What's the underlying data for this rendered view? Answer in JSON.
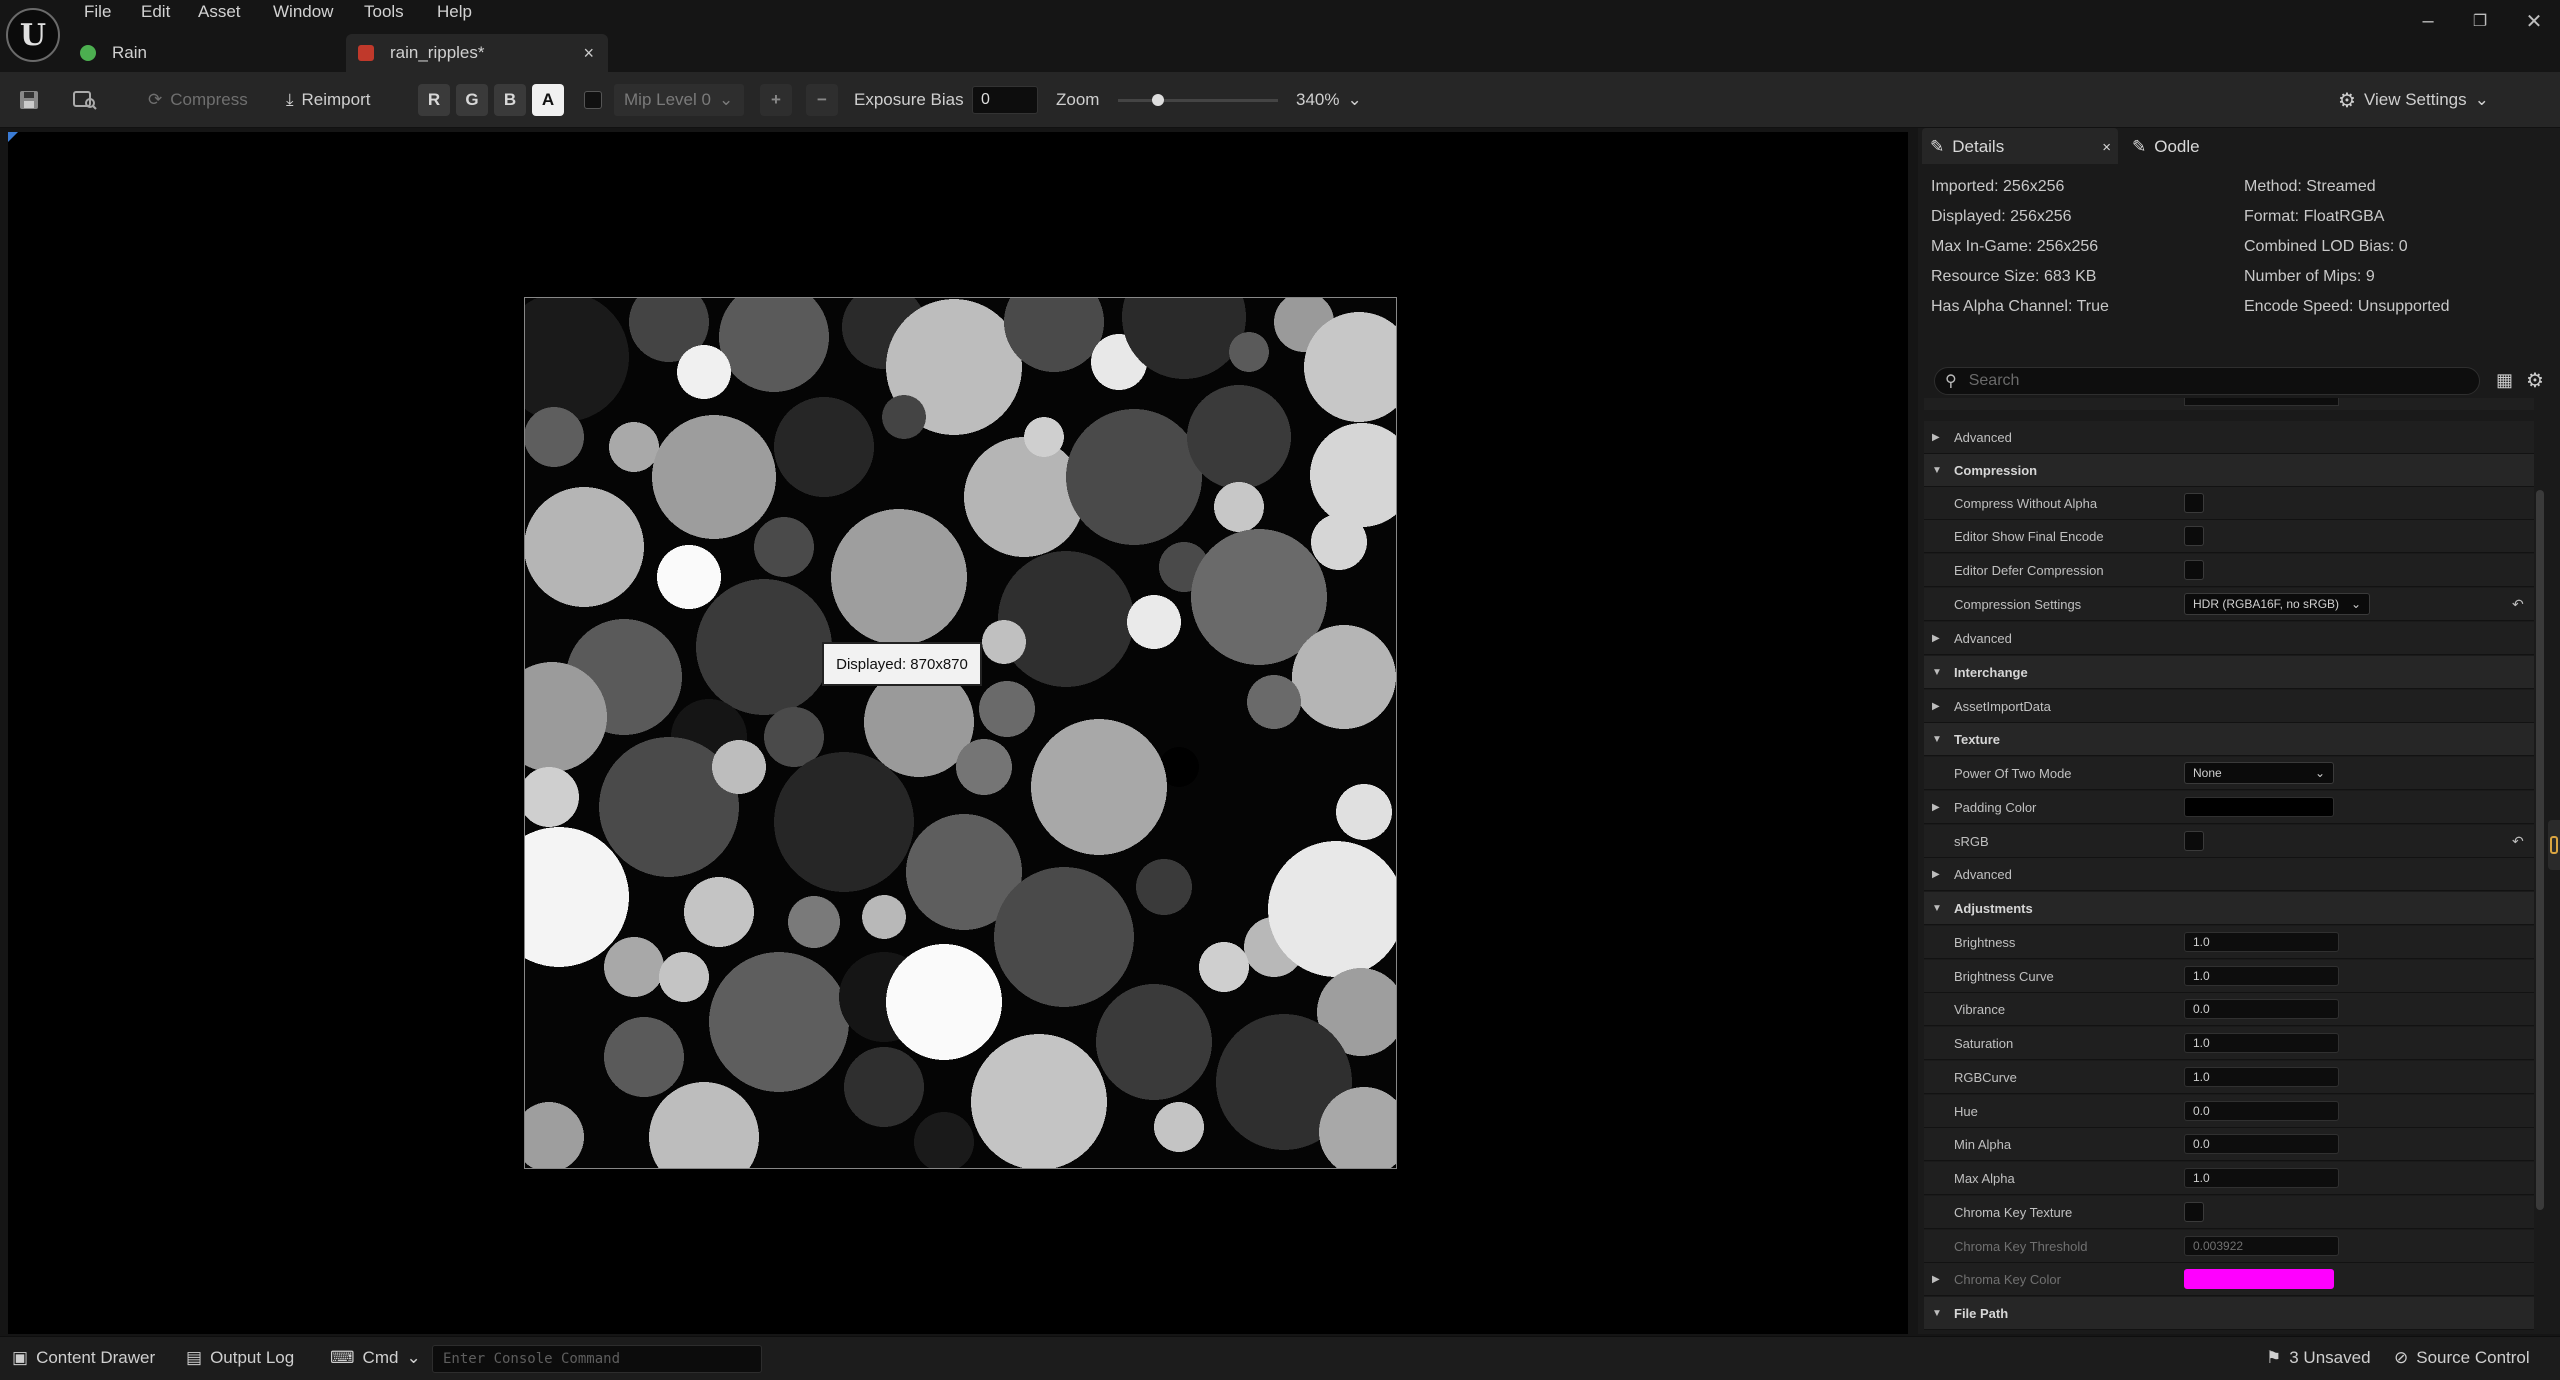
{
  "menu": [
    "File",
    "Edit",
    "Asset",
    "Window",
    "Tools",
    "Help"
  ],
  "tabs": [
    {
      "label": "Rain"
    },
    {
      "label": "rain_ripples*"
    }
  ],
  "toolbar": {
    "compress": "Compress",
    "reimport": "Reimport",
    "channels": [
      "R",
      "G",
      "B",
      "A"
    ],
    "mip": "Mip Level 0",
    "exposure_label": "Exposure Bias",
    "exposure_value": "0",
    "zoom_label": "Zoom",
    "zoom_value": "340%",
    "zoom_slider_fraction": 0.25,
    "view_settings": "View Settings"
  },
  "viewport": {
    "tooltip": "Displayed: 870x870"
  },
  "panel": {
    "tabs": [
      "Details",
      "Oodle"
    ],
    "info_left": [
      "Imported: 256x256",
      "Displayed: 256x256",
      "Max In-Game: 256x256",
      "Resource Size: 683 KB",
      "Has Alpha Channel: True"
    ],
    "info_right": [
      "Method: Streamed",
      "Format: FloatRGBA",
      "Combined LOD Bias: 0",
      "Number of Mips: 9",
      "Encode Speed: Unsupported"
    ],
    "search_placeholder": "Search",
    "props": {
      "advanced": "Advanced",
      "compression": "Compression",
      "compress_without_alpha": "Compress Without Alpha",
      "editor_show_final_encode": "Editor Show Final Encode",
      "editor_defer_compression": "Editor Defer Compression",
      "compression_settings": "Compression Settings",
      "compression_settings_value": "HDR (RGBA16F, no sRGB)",
      "interchange": "Interchange",
      "asset_import_data": "AssetImportData",
      "texture": "Texture",
      "power_of_two_mode": "Power Of Two Mode",
      "power_of_two_value": "None",
      "padding_color": "Padding Color",
      "srgb": "sRGB",
      "adjustments": "Adjustments",
      "brightness": "Brightness",
      "brightness_value": "1.0",
      "brightness_curve": "Brightness Curve",
      "brightness_curve_value": "1.0",
      "vibrance": "Vibrance",
      "vibrance_value": "0.0",
      "saturation": "Saturation",
      "saturation_value": "1.0",
      "rgbcurve": "RGBCurve",
      "rgbcurve_value": "1.0",
      "hue": "Hue",
      "hue_value": "0.0",
      "min_alpha": "Min Alpha",
      "min_alpha_value": "0.0",
      "max_alpha": "Max Alpha",
      "max_alpha_value": "1.0",
      "chroma_key_texture": "Chroma Key Texture",
      "chroma_key_threshold": "Chroma Key Threshold",
      "chroma_key_threshold_value": "0.003922",
      "chroma_key_color": "Chroma Key Color",
      "file_path": "File Path"
    },
    "colors": {
      "chroma_key": "#ff00ff",
      "padding": "#000000"
    }
  },
  "status": {
    "content_drawer": "Content Drawer",
    "output_log": "Output Log",
    "cmd": "Cmd",
    "console_placeholder": "Enter Console Command",
    "unsaved": "3 Unsaved",
    "source_control": "Source Control"
  }
}
